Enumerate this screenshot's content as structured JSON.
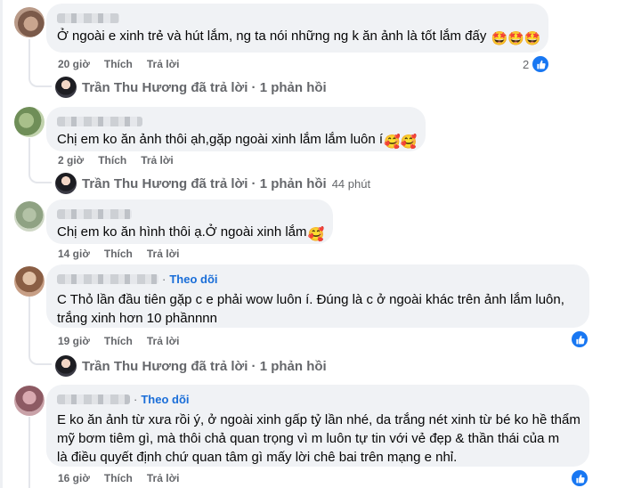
{
  "comments": [
    {
      "text": "Ở ngoài e xinh trẻ và hút lắm, ng ta nói những ng k ăn ảnh là tốt lắm đấy",
      "emojis": "🤩🤩🤩",
      "time": "20 giờ",
      "like_label": "Thích",
      "reply_label": "Trả lời",
      "reaction_count": "2",
      "reply_summary": "Trần Thu Hương đã trả lời · 1 phản hồi",
      "reply_time": ""
    },
    {
      "text": "Chị em ko ăn ảnh thôi ạh,gặp ngoài xinh lắm lắm luôn í",
      "emojis": "🥰🥰",
      "time": "2 giờ",
      "like_label": "Thích",
      "reply_label": "Trả lời",
      "reply_summary": "Trần Thu Hương đã trả lời · 1 phản hồi",
      "reply_time": "44 phút"
    },
    {
      "text": "Chị em ko ăn hình thôi ạ.Ở ngoài xinh lắm",
      "emojis": "🥰",
      "time": "14 giờ",
      "like_label": "Thích",
      "reply_label": "Trả lời"
    },
    {
      "follow_label": "Theo dõi",
      "text_lines": [
        "C Thỏ lần đầu tiên gặp c e phải wow luôn í. Đúng là c ở ngoài khác trên ảnh lắm luôn,",
        "trắng xinh hơn 10 phầnnnn"
      ],
      "time": "19 giờ",
      "like_label": "Thích",
      "reply_label": "Trả lời",
      "reply_summary": "Trần Thu Hương đã trả lời · 1 phản hồi"
    },
    {
      "follow_label": "Theo dõi",
      "text_lines": [
        "E ko ăn ảnh từ xưa rồi ý, ở ngoài xinh gấp tỷ lần nhé, da trắng nét xinh từ bé ko hề thẩm",
        "mỹ bơm tiêm gì, mà thôi chả quan trọng vì m luôn tự tin với vẻ đẹp & thần thái của m",
        "là điều quyết định chứ quan tâm gì mấy lời chê bai trên mạng e nhỉ."
      ],
      "time": "16 giờ",
      "like_label": "Thích",
      "reply_label": "Trả lời"
    }
  ],
  "colors": {
    "bubble": "#f0f2f5",
    "meta_text": "#65676b",
    "follow": "#1a6ed8",
    "like_blue": "#1877f2"
  },
  "icons": {
    "reaction": "like-thumb-icon"
  }
}
